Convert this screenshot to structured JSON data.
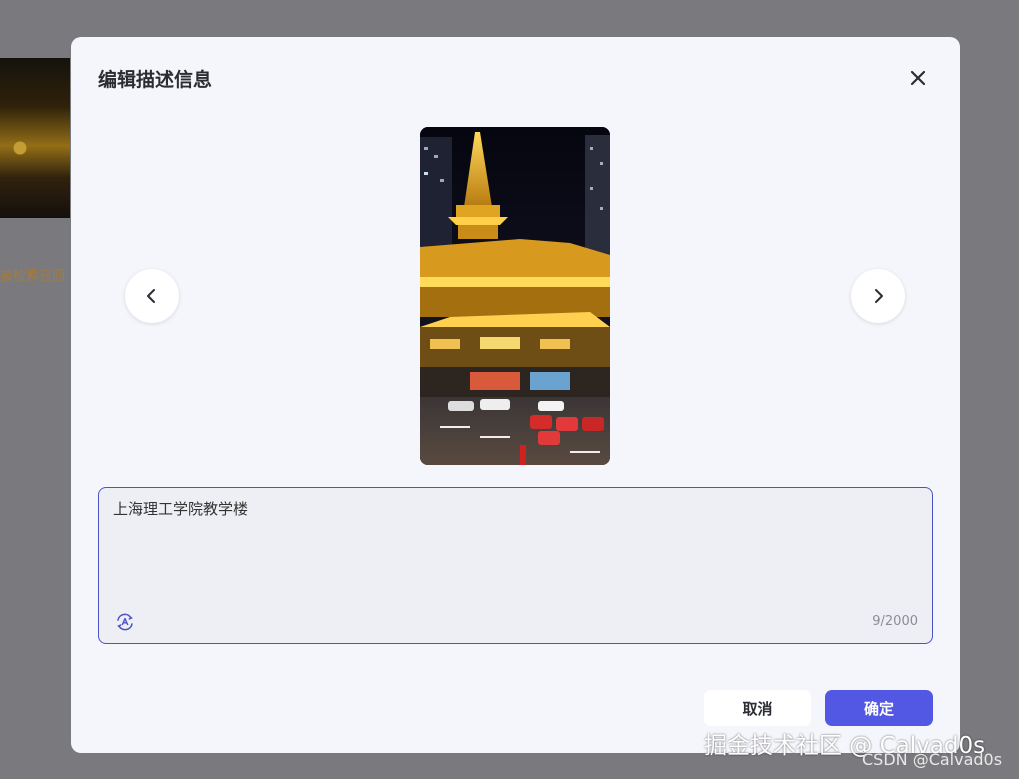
{
  "background": {
    "behind_text": "被检索召回"
  },
  "modal": {
    "title": "编辑描述信息",
    "close_icon": "close-icon",
    "prev_icon": "chevron-left-icon",
    "next_icon": "chevron-right-icon",
    "description": {
      "value": "上海理工学院教学楼",
      "counter": "9/2000",
      "ai_icon": "ai-rewrite-icon"
    },
    "cancel_label": "取消",
    "confirm_label": "确定"
  },
  "watermark": {
    "line1": "掘金技术社区 @ Calvad0s",
    "line2": "CSDN @Calvad0s"
  },
  "colors": {
    "accent": "#5258e4",
    "border_focus": "#4d52c4",
    "modal_bg": "#f5f6fb",
    "overlay": "#7a7a7e"
  }
}
